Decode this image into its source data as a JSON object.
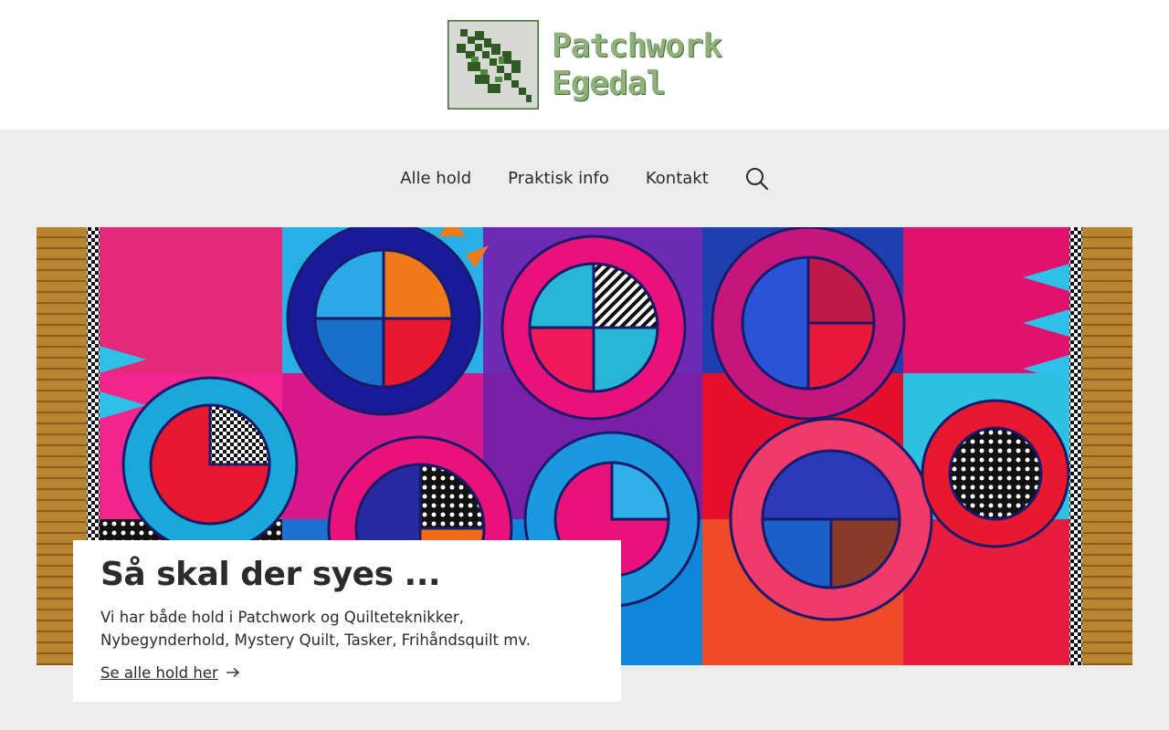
{
  "header": {
    "logo_line1": "Patchwork",
    "logo_line2": "Egedal",
    "logo_icon": "oak-leaf-quilt-icon"
  },
  "nav": {
    "items": [
      {
        "label": "Alle hold"
      },
      {
        "label": "Praktisk info"
      },
      {
        "label": "Kontakt"
      }
    ],
    "search_icon": "search-icon"
  },
  "hero": {
    "image": "colorful-quilt-image"
  },
  "card": {
    "title": "Så skal der syes ...",
    "text": "Vi har både hold i Patchwork og Quilteteknikker, Nybegynderhold, Mystery Quilt, Tasker, Frihåndsquilt mv.",
    "link_label": "Se alle hold her",
    "link_icon": "arrow-right-icon"
  },
  "colors": {
    "page_bg": "#ededed",
    "header_bg": "#ffffff",
    "text": "#2b2b2b",
    "logo_green": "#8fb07a"
  }
}
